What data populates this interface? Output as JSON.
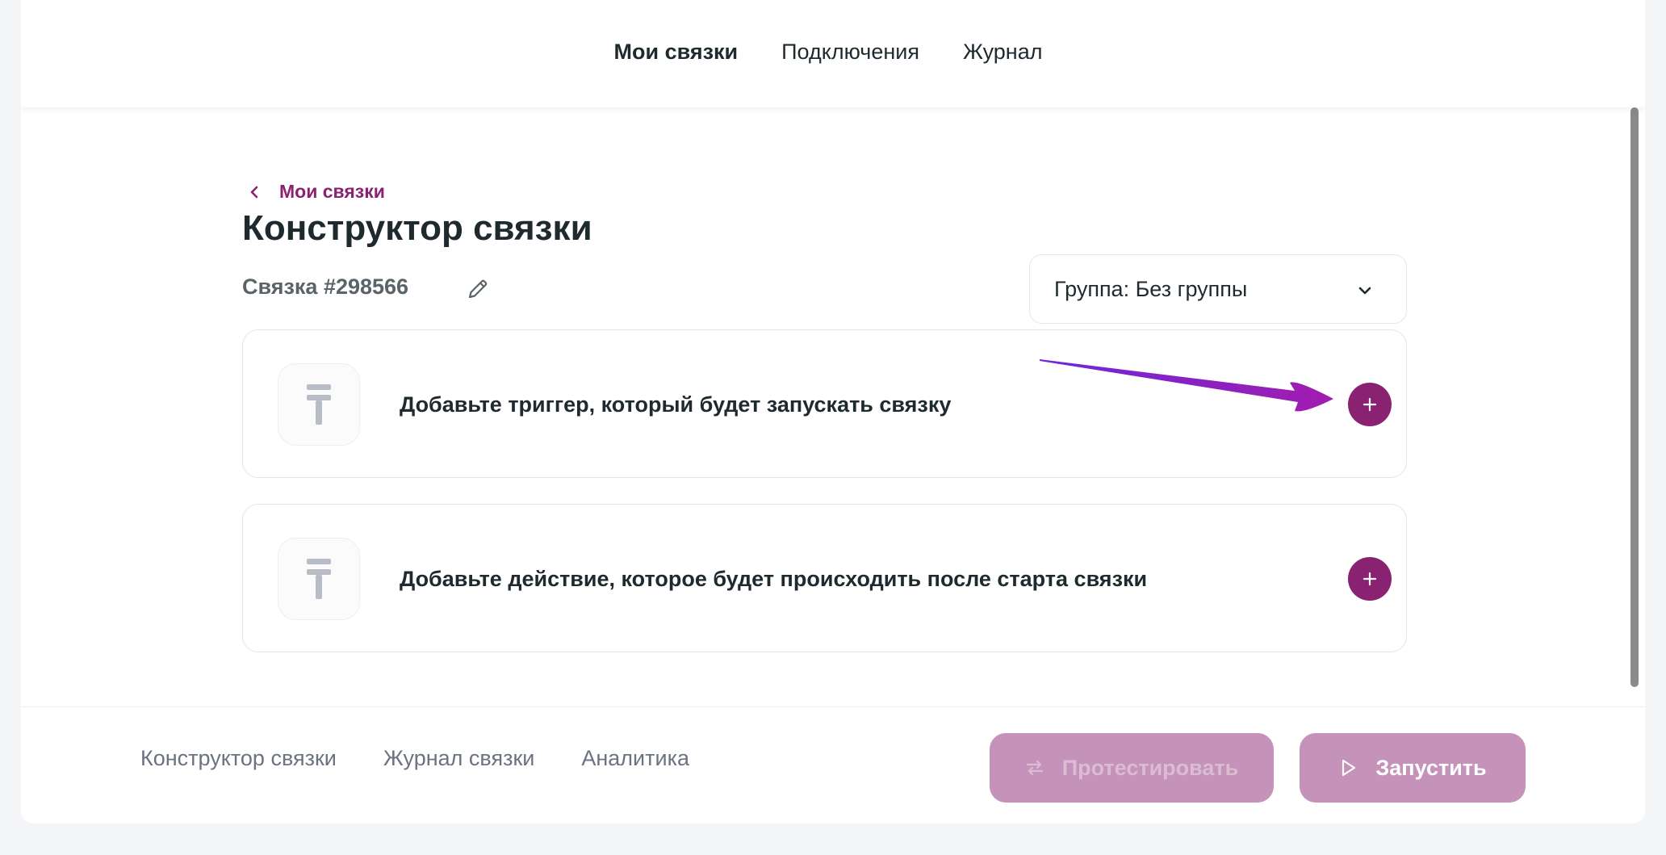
{
  "topnav": {
    "items": [
      {
        "label": "Мои связки",
        "active": true
      },
      {
        "label": "Подключения",
        "active": false
      },
      {
        "label": "Журнал",
        "active": false
      }
    ]
  },
  "breadcrumb": {
    "back_label": "Мои связки"
  },
  "page": {
    "title": "Конструктор связки",
    "bundle_id": "Связка #298566"
  },
  "group_select": {
    "value": "Группа: Без группы"
  },
  "steps": [
    {
      "text": "Добавьте триггер, который будет запускать связку",
      "icon": "placeholder-app-icon"
    },
    {
      "text": "Добавьте действие, которое будет происходить после старта связки",
      "icon": "placeholder-app-icon"
    }
  ],
  "footer": {
    "tabs": [
      "Конструктор связки",
      "Журнал связки",
      "Аналитика"
    ],
    "test_label": "Протестировать",
    "run_label": "Запустить"
  },
  "colors": {
    "accent": "#8a2272",
    "button_disabled": "#c592b9",
    "annotation_arrow": "#9b1fd6"
  }
}
